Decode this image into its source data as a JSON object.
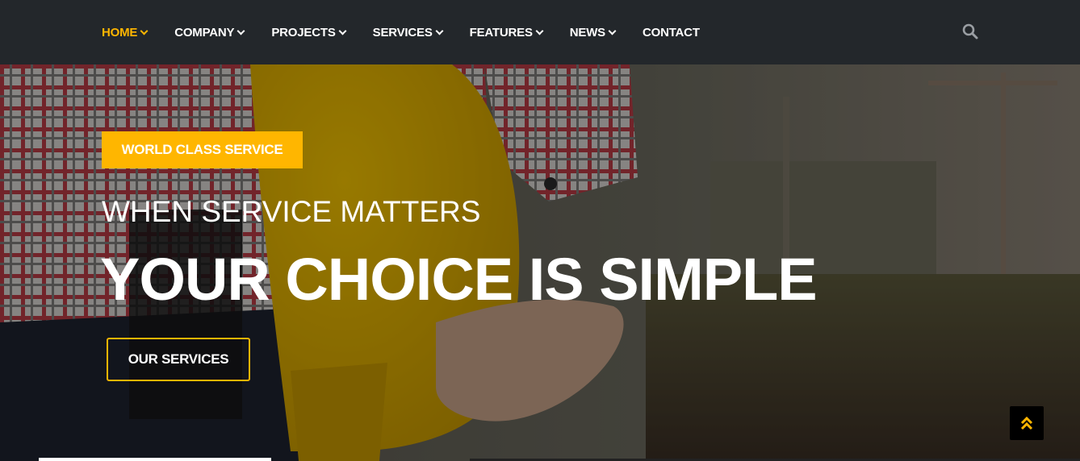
{
  "nav": {
    "items": [
      {
        "label": "HOME",
        "dropdown": true,
        "active": true
      },
      {
        "label": "COMPANY",
        "dropdown": true,
        "active": false
      },
      {
        "label": "PROJECTS",
        "dropdown": true,
        "active": false
      },
      {
        "label": "SERVICES",
        "dropdown": true,
        "active": false
      },
      {
        "label": "FEATURES",
        "dropdown": true,
        "active": false
      },
      {
        "label": "NEWS",
        "dropdown": true,
        "active": false
      },
      {
        "label": "CONTACT",
        "dropdown": false,
        "active": false
      }
    ],
    "search_icon": "search-icon"
  },
  "hero": {
    "badge": "WORLD CLASS SERVICE",
    "subtitle": "WHEN SERVICE MATTERS",
    "title": "YOUR CHOICE IS SIMPLE",
    "cta_label": "OUR SERVICES",
    "back_to_top_icon": "double-chevron-up-icon"
  },
  "colors": {
    "accent": "#ffb600",
    "nav_bg": "#23272b",
    "text": "#ffffff"
  }
}
